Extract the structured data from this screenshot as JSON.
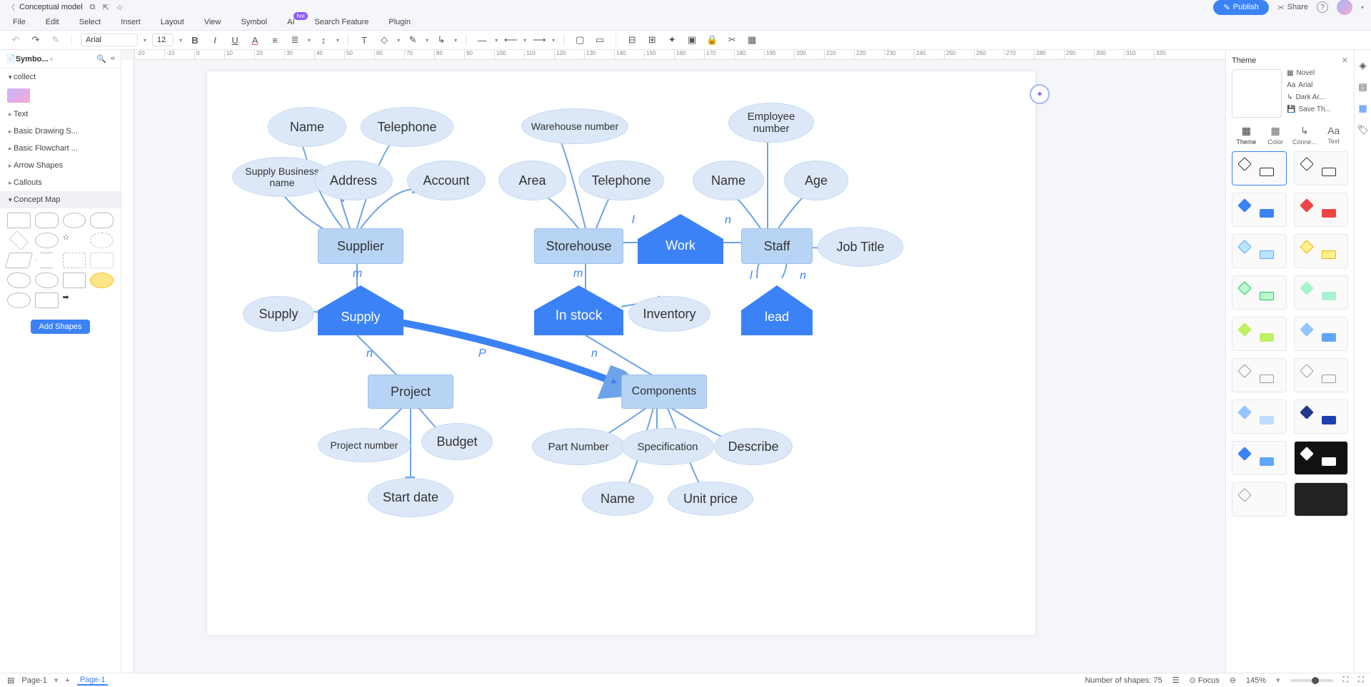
{
  "top": {
    "title": "Conceptual model",
    "publish": "Publish",
    "share": "Share"
  },
  "menu": [
    "File",
    "Edit",
    "Select",
    "Insert",
    "Layout",
    "View",
    "Symbol",
    "AI",
    "Search Feature",
    "Plugin"
  ],
  "ai_badge": "hot",
  "toolbar": {
    "font": "Arial",
    "size": "12"
  },
  "left": {
    "title": "Symbo...",
    "collect": "collect",
    "sections": [
      "Text",
      "Basic Drawing S...",
      "Basic Flowchart ...",
      "Arrow Shapes",
      "Callouts",
      "Concept Map"
    ],
    "add": "Add Shapes"
  },
  "right": {
    "title": "Theme",
    "novel": "Novel",
    "font": "Arial",
    "dark": "Dark Ar...",
    "save": "Save Th...",
    "tabs": [
      "Theme",
      "Color",
      "Conne...",
      "Text"
    ]
  },
  "status": {
    "page": "Page-1",
    "tab": "Page-1",
    "shapes": "Number of shapes: 75",
    "focus": "Focus",
    "zoom": "145%"
  },
  "diagram": {
    "entities": {
      "supplier": "Supplier",
      "storehouse": "Storehouse",
      "staff": "Staff",
      "project": "Project",
      "components": "Components"
    },
    "rels": {
      "work": "Work",
      "supply": "Supply",
      "instock": "In stock",
      "lead": "lead"
    },
    "attrs": {
      "name1": "Name",
      "telephone1": "Telephone",
      "warehouse": "Warehouse number",
      "employee": "Employee number",
      "sbn": "Supply Business name",
      "address": "Address",
      "account": "Account",
      "area": "Area",
      "telephone2": "Telephone",
      "name2": "Name",
      "age": "Age",
      "jobtitle": "Job Title",
      "supply_a": "Supply",
      "inventory": "Inventory",
      "projnum": "Project number",
      "budget": "Budget",
      "startdate": "Start date",
      "partnum": "Part Number",
      "spec": "Specification",
      "describe": "Describe",
      "name3": "Name",
      "unitprice": "Unit price"
    },
    "labels": {
      "m1": "m",
      "m2": "m",
      "l1": "l",
      "l2": "l",
      "n1": "n",
      "n2": "n",
      "n3": "n",
      "p": "P"
    }
  },
  "ruler": [
    "-20",
    "-10",
    "0",
    "10",
    "20",
    "30",
    "40",
    "50",
    "60",
    "70",
    "80",
    "90",
    "100",
    "110",
    "120",
    "130",
    "140",
    "150",
    "160",
    "170",
    "180",
    "190",
    "200",
    "210",
    "220",
    "230",
    "240",
    "250",
    "260",
    "270",
    "280",
    "290",
    "300",
    "310",
    "320"
  ]
}
